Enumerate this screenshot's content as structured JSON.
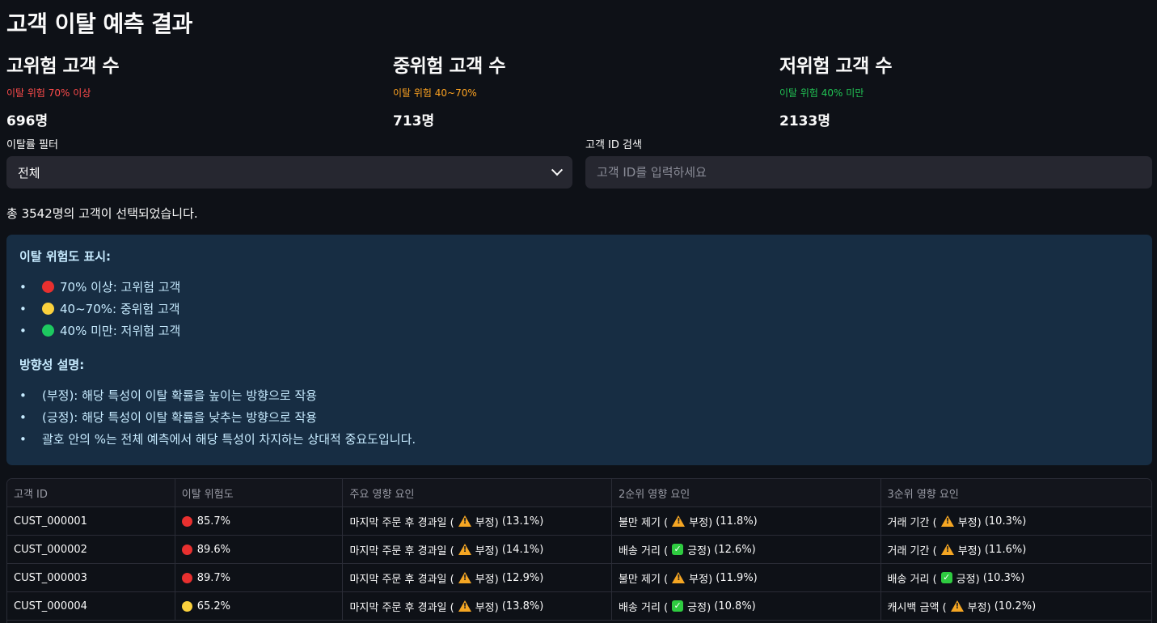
{
  "page_title": "고객 이탈 예측 결과",
  "metrics": [
    {
      "label": "고위험 고객 수",
      "sub": "이탈 위험 70% 이상",
      "value": "696명",
      "color": "#ff4b4b"
    },
    {
      "label": "중위험 고객 수",
      "sub": "이탈 위험 40~70%",
      "value": "713명",
      "color": "#ffa421"
    },
    {
      "label": "저위험 고객 수",
      "sub": "이탈 위험 40% 미만",
      "value": "2133명",
      "color": "#21c354"
    }
  ],
  "filter": {
    "label": "이탈률 필터",
    "selected": "전체"
  },
  "search": {
    "label": "고객 ID 검색",
    "placeholder": "고객 ID를 입력하세요",
    "value": ""
  },
  "count_text": "총 3542명의 고객이 선택되었습니다.",
  "info": {
    "risk_title": "이탈 위험도 표시:",
    "risk_items": [
      {
        "dot": "red",
        "text": "70% 이상: 고위험 고객"
      },
      {
        "dot": "yellow",
        "text": "40~70%: 중위험 고객"
      },
      {
        "dot": "green",
        "text": "40% 미만: 저위험 고객"
      }
    ],
    "direction_title": "방향성 설명:",
    "direction_items": [
      "(부정): 해당 특성이 이탈 확률을 높이는 방향으로 작용",
      "(긍정): 해당 특성이 이탈 확률을 낮추는 방향으로 작용",
      "괄호 안의 %는 전체 예측에서 해당 특성이 차지하는 상대적 중요도입니다."
    ]
  },
  "table": {
    "headers": [
      "고객 ID",
      "이탈 위험도",
      "주요 영향 요인",
      "2순위 영향 요인",
      "3순위 영향 요인"
    ],
    "rows": [
      {
        "id": "CUST_000001",
        "dot": "red",
        "risk": "85.7%",
        "f1": {
          "name": "마지막 주문 후 경과일 (",
          "icon": "warn",
          "dir": "부정)",
          "pct": "(13.1%)"
        },
        "f2": {
          "name": "불만 제기 (",
          "icon": "warn",
          "dir": "부정)",
          "pct": "(11.8%)"
        },
        "f3": {
          "name": "거래 기간 (",
          "icon": "warn",
          "dir": "부정)",
          "pct": "(10.3%)"
        }
      },
      {
        "id": "CUST_000002",
        "dot": "red",
        "risk": "89.6%",
        "f1": {
          "name": "마지막 주문 후 경과일 (",
          "icon": "warn",
          "dir": "부정)",
          "pct": "(14.1%)"
        },
        "f2": {
          "name": "배송 거리 (",
          "icon": "check",
          "dir": "긍정)",
          "pct": "(12.6%)"
        },
        "f3": {
          "name": "거래 기간 (",
          "icon": "warn",
          "dir": "부정)",
          "pct": "(11.6%)"
        }
      },
      {
        "id": "CUST_000003",
        "dot": "red",
        "risk": "89.7%",
        "f1": {
          "name": "마지막 주문 후 경과일 (",
          "icon": "warn",
          "dir": "부정)",
          "pct": "(12.9%)"
        },
        "f2": {
          "name": "불만 제기 (",
          "icon": "warn",
          "dir": "부정)",
          "pct": "(11.9%)"
        },
        "f3": {
          "name": "배송 거리 (",
          "icon": "check",
          "dir": "긍정)",
          "pct": "(10.3%)"
        }
      },
      {
        "id": "CUST_000004",
        "dot": "yellow",
        "risk": "65.2%",
        "f1": {
          "name": "마지막 주문 후 경과일 (",
          "icon": "warn",
          "dir": "부정)",
          "pct": "(13.8%)"
        },
        "f2": {
          "name": "배송 거리 (",
          "icon": "check",
          "dir": "긍정)",
          "pct": "(10.8%)"
        },
        "f3": {
          "name": "캐시백 금액 (",
          "icon": "warn",
          "dir": "부정)",
          "pct": "(10.2%)"
        }
      }
    ]
  }
}
